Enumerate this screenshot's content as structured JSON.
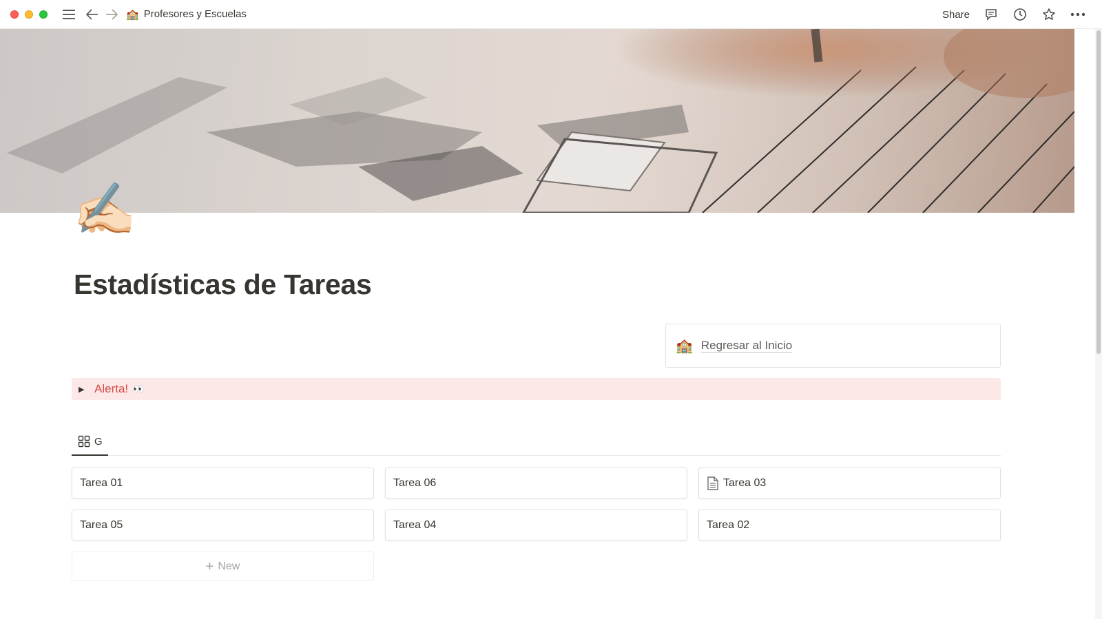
{
  "topbar": {
    "breadcrumb": {
      "emoji": "🏫",
      "label": "Profesores y Escuelas"
    },
    "share_label": "Share",
    "icons": [
      "menu-icon",
      "back-arrow-icon",
      "forward-arrow-icon",
      "comment-icon",
      "clock-icon",
      "star-icon",
      "more-icon"
    ]
  },
  "page": {
    "icon_emoji": "✍🏻",
    "title": "Estadísticas de Tareas",
    "home_link": {
      "emoji": "🏫",
      "label": "Regresar al Inicio"
    },
    "alert": {
      "label": "Alerta!",
      "emoji": "👀"
    }
  },
  "database": {
    "view_tab": {
      "icon": "gallery-icon",
      "label": "G"
    },
    "cards": [
      {
        "label": "Tarea 01",
        "has_doc_icon": false
      },
      {
        "label": "Tarea 06",
        "has_doc_icon": false
      },
      {
        "label": "Tarea 03",
        "has_doc_icon": true
      },
      {
        "label": "Tarea 05",
        "has_doc_icon": false
      },
      {
        "label": "Tarea 04",
        "has_doc_icon": false
      },
      {
        "label": "Tarea 02",
        "has_doc_icon": false
      }
    ],
    "new_label": "New"
  },
  "colors": {
    "alert_background": "#fde8e8",
    "alert_text": "#d44c47",
    "text": "#37352f"
  }
}
